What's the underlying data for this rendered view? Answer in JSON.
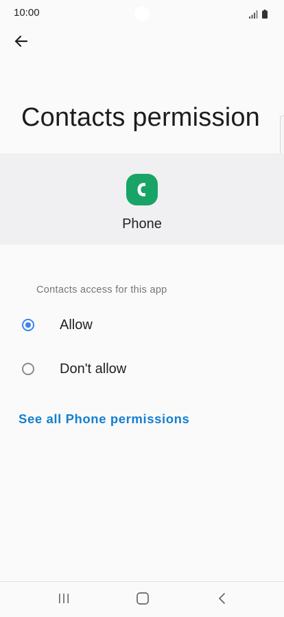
{
  "status_bar": {
    "time": "10:00",
    "icons": [
      "signal-icon",
      "battery-icon"
    ]
  },
  "toolbar": {
    "back_icon": "arrow-left-icon"
  },
  "page": {
    "title": "Contacts permission"
  },
  "app": {
    "name": "Phone",
    "icon": "phone-app-icon",
    "icon_color": "#18a466"
  },
  "permission": {
    "section_header": "Contacts access for this app",
    "options": [
      {
        "label": "Allow",
        "selected": true
      },
      {
        "label": "Don't allow",
        "selected": false
      }
    ],
    "link": "See all Phone permissions"
  },
  "colors": {
    "accent": "#3a84f0",
    "link": "#137fcf",
    "header_band": "#f0f0f2"
  },
  "nav_bar": {
    "buttons": [
      "recents-icon",
      "home-icon",
      "back-icon"
    ]
  }
}
